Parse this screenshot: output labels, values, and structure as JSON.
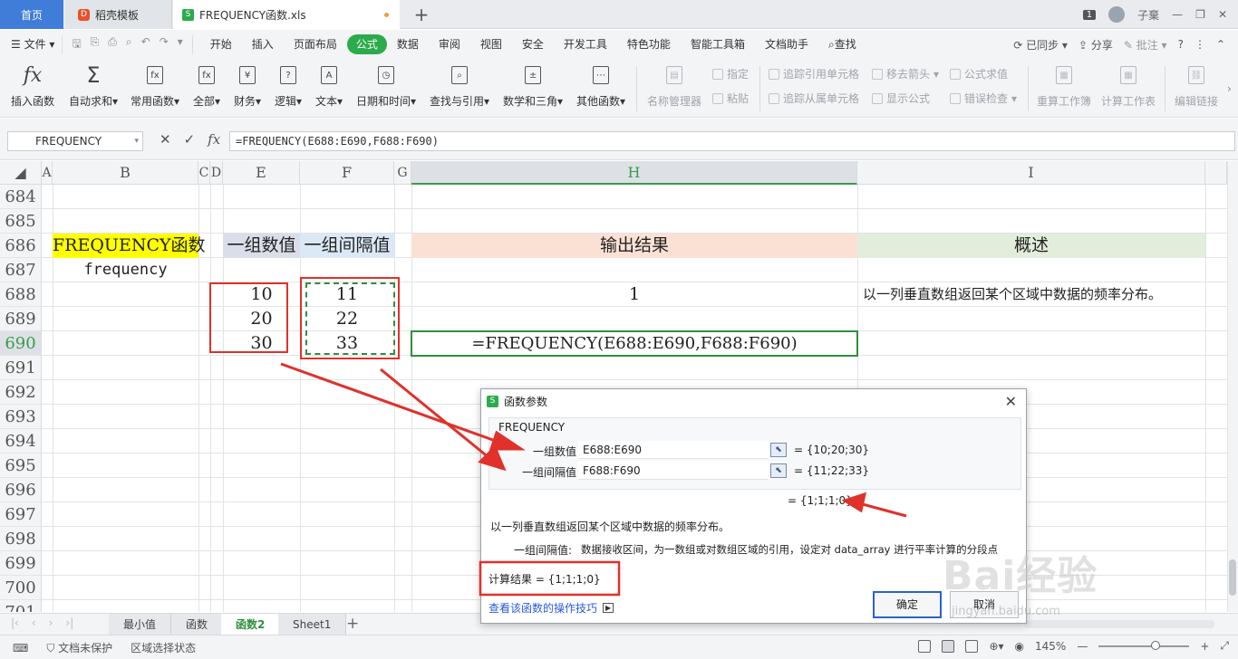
{
  "tabs": {
    "home": "首页",
    "daoke": "稻壳模板",
    "file": "FREQUENCY函数.xls",
    "new_tab": "+",
    "window_count": "1",
    "user": "子棄"
  },
  "menu": {
    "file": "文件",
    "items": [
      "开始",
      "插入",
      "页面布局",
      "公式",
      "数据",
      "审阅",
      "视图",
      "安全",
      "开发工具",
      "特色功能",
      "智能工具箱",
      "文档助手"
    ],
    "active": "公式",
    "search": "查找",
    "synced": "已同步",
    "share": "分享",
    "annotate": "批注",
    "help": "?"
  },
  "ribbon": {
    "insert_fn": "插入函数",
    "autosum": "自动求和",
    "common_fn": "常用函数",
    "all": "全部",
    "finance": "财务",
    "logic": "逻辑",
    "text": "文本",
    "datetime": "日期和时间",
    "lookup": "查找与引用",
    "math": "数学和三角",
    "other": "其他函数",
    "name_mgr": "名称管理器",
    "define": "指定",
    "paste": "粘贴",
    "trace_prec": "追踪引用单元格",
    "trace_dep": "追踪从属单元格",
    "remove_arrows": "移去箭头",
    "show_formula": "显示公式",
    "eval_formula": "公式求值",
    "error_check": "错误检查",
    "recalc_wb": "重算工作簿",
    "calc_sheet": "计算工作表",
    "edit_links": "编辑链接"
  },
  "formula_bar": {
    "name_box": "FREQUENCY",
    "formula": "=FREQUENCY(E688:E690,F688:F690)"
  },
  "columns": [
    "A",
    "B",
    "C",
    "D",
    "E",
    "F",
    "G",
    "H",
    "I"
  ],
  "rows": [
    "684",
    "685",
    "686",
    "687",
    "688",
    "689",
    "690",
    "691",
    "692",
    "693",
    "694",
    "695",
    "696",
    "697",
    "698",
    "699",
    "700",
    "701"
  ],
  "cells": {
    "b686": "FREQUENCY函数",
    "b687": "frequency",
    "e686": "一组数值",
    "f686": "一组间隔值",
    "h686": "输出结果",
    "i686": "概述",
    "e688": "10",
    "e689": "20",
    "e690": "30",
    "f688": "11",
    "f689": "22",
    "f690": "33",
    "h688": "1",
    "h690": "=FREQUENCY(E688:E690,F688:F690)",
    "i688": "以一列垂直数组返回某个区域中数据的频率分布。"
  },
  "dialog": {
    "title": "函数参数",
    "fn_name": "FREQUENCY",
    "arg1_label": "一组数值",
    "arg1_value": "E688:E690",
    "arg1_result": "= {10;20;30}",
    "arg2_label": "一组间隔值",
    "arg2_value": "F688:F690",
    "arg2_result": "= {11;22;33}",
    "overall_result": "= {1;1;1;0}",
    "description": "以一列垂直数组返回某个区域中数据的频率分布。",
    "arg_help_label": "一组间隔值:",
    "arg_help": "数据接收区间，为一数组或对数组区域的引用，设定对 data_array 进行平率计算的分段点",
    "calc_result": "计算结果 = {1;1;1;0}",
    "link": "查看该函数的操作技巧",
    "ok": "确定",
    "cancel": "取消"
  },
  "sheets": [
    "最小值",
    "函数",
    "函数2",
    "Sheet1"
  ],
  "active_sheet": "函数2",
  "status": {
    "protect": "文档未保护",
    "select_mode": "区域选择状态",
    "zoom": "145%"
  },
  "watermark": {
    "brand": "Bai经验",
    "url": "jingyan.baidu.com"
  },
  "colors": {
    "accent_green": "#2bab4c",
    "annotation_red": "#e0312b",
    "yellow": "#ffff00",
    "peach": "#fbe1d4",
    "light_green": "#e2eedb"
  }
}
